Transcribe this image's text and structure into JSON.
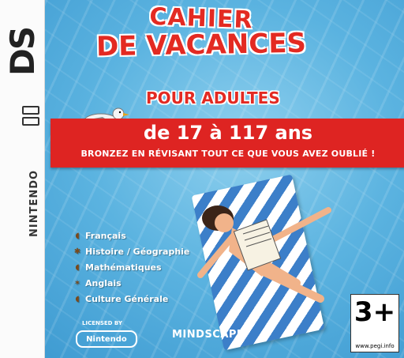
{
  "title": {
    "line1": "CAHIER",
    "line2": "DE VACANCES",
    "line3": "POUR ADULTES"
  },
  "banner": {
    "age_range": "de 17 à 117 ans",
    "tagline": "BRONZEZ EN RÉVISANT TOUT CE QUE VOUS AVEZ OUBLIÉ !"
  },
  "platform": {
    "logo": "DS",
    "name": "NINTENDO"
  },
  "subjects": [
    {
      "label": "Français",
      "icon": "shell-icon"
    },
    {
      "label": "Histoire / Géographie",
      "icon": "palm-icon"
    },
    {
      "label": "Mathématiques",
      "icon": "shell-icon"
    },
    {
      "label": "Anglais",
      "icon": "starfish-icon"
    },
    {
      "label": "Culture Générale",
      "icon": "shell-icon"
    }
  ],
  "footer": {
    "licensed_by": "LICENSED BY",
    "licensor": "Nintendo",
    "publisher": "MINDSCAPE"
  },
  "rating": {
    "value": "3+",
    "site": "www.pegi.info"
  },
  "colors": {
    "accent_red": "#de2422",
    "water": "#5bb3e0",
    "towel_blue": "#3c7fc9"
  }
}
